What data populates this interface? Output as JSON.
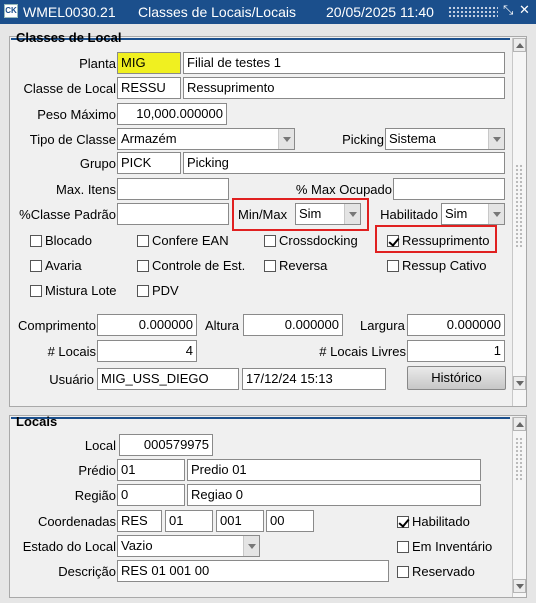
{
  "window": {
    "app_code": "WMEL0030.21",
    "title": "Classes de Locais/Locais",
    "datetime": "20/05/2025 11:40",
    "icon": "app-icon",
    "controls": [
      "restore-icon",
      "close-icon"
    ],
    "accent_color": "#1b4f8c"
  },
  "classes": {
    "title": "Classes de Local",
    "planta_label": "Planta",
    "planta_code": "MIG",
    "planta_desc": "Filial de testes 1",
    "classe_label": "Classe de Local",
    "classe_code": "RESSU",
    "classe_desc": "Ressuprimento",
    "peso_label": "Peso Máximo",
    "peso_value": "10,000.000000",
    "tipo_label": "Tipo de Classe",
    "tipo_value": "Armazém",
    "picking_label": "Picking",
    "picking_value": "Sistema",
    "grupo_label": "Grupo",
    "grupo_code": "PICK",
    "grupo_desc": "Picking",
    "max_itens_label": "Max. Itens",
    "max_itens_value": "",
    "pct_max_label": "% Max Ocupado",
    "pct_max_value": "",
    "pct_classe_label": "%Classe Padrão",
    "pct_classe_value": "",
    "minmax_label": "Min/Max",
    "minmax_value": "Sim",
    "habilitado_label": "Habilitado",
    "habilitado_value": "Sim",
    "checks": [
      {
        "label": "Blocado",
        "checked": false
      },
      {
        "label": "Confere EAN",
        "checked": false
      },
      {
        "label": "Crossdocking",
        "checked": false
      },
      {
        "label": "Ressuprimento",
        "checked": true
      },
      {
        "label": "Avaria",
        "checked": false
      },
      {
        "label": "Controle de Est.",
        "checked": false
      },
      {
        "label": "Reversa",
        "checked": false
      },
      {
        "label": "Ressup Cativo",
        "checked": false
      },
      {
        "label": "Mistura Lote",
        "checked": false
      },
      {
        "label": "PDV",
        "checked": false
      }
    ],
    "comprimento_label": "Comprimento",
    "comprimento_value": "0.000000",
    "altura_label": "Altura",
    "altura_value": "0.000000",
    "largura_label": "Largura",
    "largura_value": "0.000000",
    "locais_label": "# Locais",
    "locais_value": "4",
    "locais_livres_label": "# Locais Livres",
    "locais_livres_value": "1",
    "usuario_label": "Usuário",
    "usuario_value": "MIG_USS_DIEGO",
    "usuario_datetime": "17/12/24 15:13",
    "historico_button": "Histórico",
    "highlight_color": "#e02020"
  },
  "locais": {
    "title": "Locais",
    "local_label": "Local",
    "local_value": "000579975",
    "predio_label": "Prédio",
    "predio_code": "01",
    "predio_desc": "Predio 01",
    "regiao_label": "Região",
    "regiao_code": "0",
    "regiao_desc": "Regiao 0",
    "coord_label": "Coordenadas",
    "coords": [
      "RES",
      "01",
      "001",
      "00"
    ],
    "estado_label": "Estado do Local",
    "estado_value": "Vazio",
    "descricao_label": "Descrição",
    "descricao_value": "RES 01 001 00",
    "checks": [
      {
        "label": "Habilitado",
        "checked": true
      },
      {
        "label": "Em Inventário",
        "checked": false
      },
      {
        "label": "Reservado",
        "checked": false
      }
    ]
  }
}
